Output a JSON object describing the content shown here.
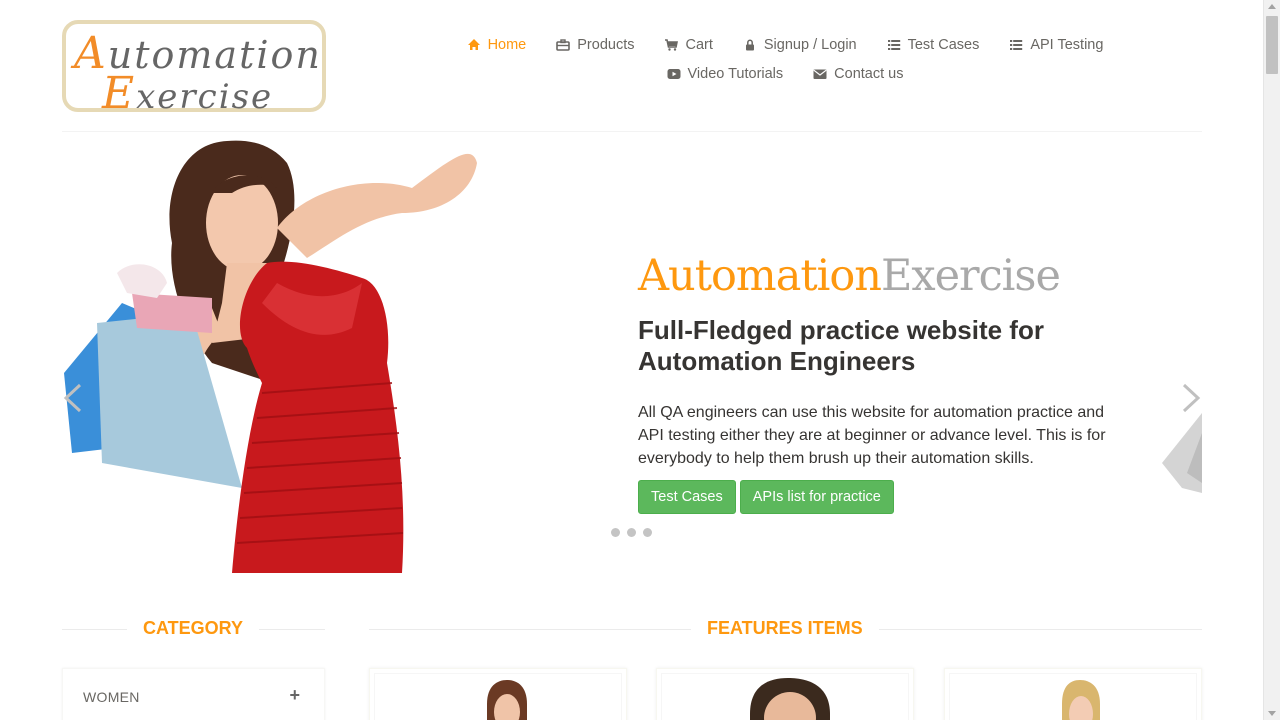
{
  "header": {
    "logo": {
      "line1_big": "A",
      "line1_rest": "utomation",
      "line2_big": "E",
      "line2_rest": "xercise"
    },
    "nav": [
      {
        "label": "Home",
        "icon": "home-icon",
        "active": true
      },
      {
        "label": "Products",
        "icon": "briefcase-icon",
        "active": false
      },
      {
        "label": "Cart",
        "icon": "cart-icon",
        "active": false
      },
      {
        "label": "Signup / Login",
        "icon": "lock-icon",
        "active": false
      },
      {
        "label": "Test Cases",
        "icon": "list-icon",
        "active": false
      },
      {
        "label": "API Testing",
        "icon": "list-icon",
        "active": false
      },
      {
        "label": "Video Tutorials",
        "icon": "youtube-play-icon",
        "active": false
      },
      {
        "label": "Contact us",
        "icon": "envelope-icon",
        "active": false
      }
    ]
  },
  "slider": {
    "brand_part1": "Automation",
    "brand_part2": "Exercise",
    "headline": "Full-Fledged practice website for Automation Engineers",
    "description": "All QA engineers can use this website for automation practice and API testing either they are at beginner or advance level. This is for everybody to help them brush up their automation skills.",
    "buttons": [
      "Test Cases",
      "APIs list for practice"
    ],
    "dot_count": 3
  },
  "sections": {
    "category_title": "CATEGORY",
    "features_title": "FEATURES ITEMS"
  },
  "category": {
    "items": [
      {
        "label": "WOMEN",
        "toggle": "+"
      }
    ]
  },
  "colors": {
    "accent": "#FE980F",
    "button_green": "#5CB85C",
    "nav_text": "#696763",
    "brand_grey": "#A9A9A9"
  }
}
